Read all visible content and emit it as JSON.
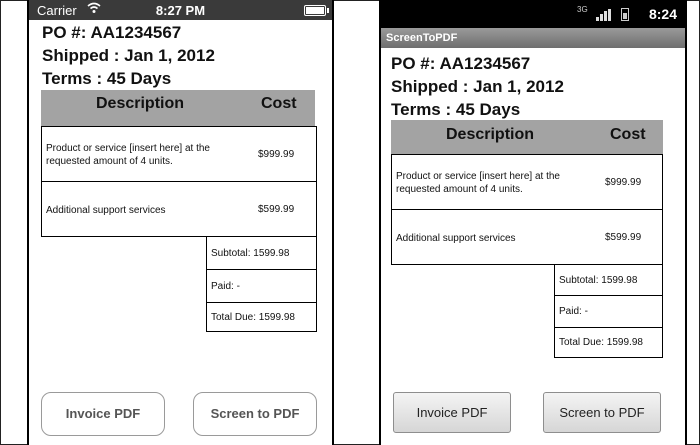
{
  "ios": {
    "status": {
      "carrier": "Carrier",
      "time": "8:27 PM"
    },
    "po": "PO #: AA1234567",
    "shipped": "Shipped : Jan 1, 2012",
    "terms": "Terms : 45 Days",
    "table": {
      "headers": {
        "description": "Description",
        "cost": "Cost"
      },
      "rows": [
        {
          "description": "Product or service [insert here] at the requested amount of 4 units.",
          "cost": "$999.99"
        },
        {
          "description": "Additional support services",
          "cost": "$599.99"
        }
      ],
      "summary": {
        "subtotal": "Subtotal: 1599.98",
        "paid": "Paid:   -",
        "total_due": "Total Due: 1599.98"
      }
    },
    "buttons": {
      "invoice": "Invoice PDF",
      "screen": "Screen to PDF"
    }
  },
  "android": {
    "status": {
      "time": "8:24",
      "network": "3G"
    },
    "app_title": "ScreenToPDF",
    "po": "PO #: AA1234567",
    "shipped": "Shipped : Jan 1, 2012",
    "terms": "Terms : 45 Days",
    "table": {
      "headers": {
        "description": "Description",
        "cost": "Cost"
      },
      "rows": [
        {
          "description": "Product or service [insert here] at the requested amount of 4 units.",
          "cost": "$999.99"
        },
        {
          "description": "Additional support services",
          "cost": "$599.99"
        }
      ],
      "summary": {
        "subtotal": "Subtotal: 1599.98",
        "paid": "Paid:   -",
        "total_due": "Total Due: 1599.98"
      }
    },
    "buttons": {
      "invoice": "Invoice PDF",
      "screen": "Screen to PDF"
    }
  },
  "colors": {
    "table_header": "#a3a3a3",
    "ios_status_bar": "#3a3a3a",
    "android_title_bar": "#7a7a7a"
  }
}
